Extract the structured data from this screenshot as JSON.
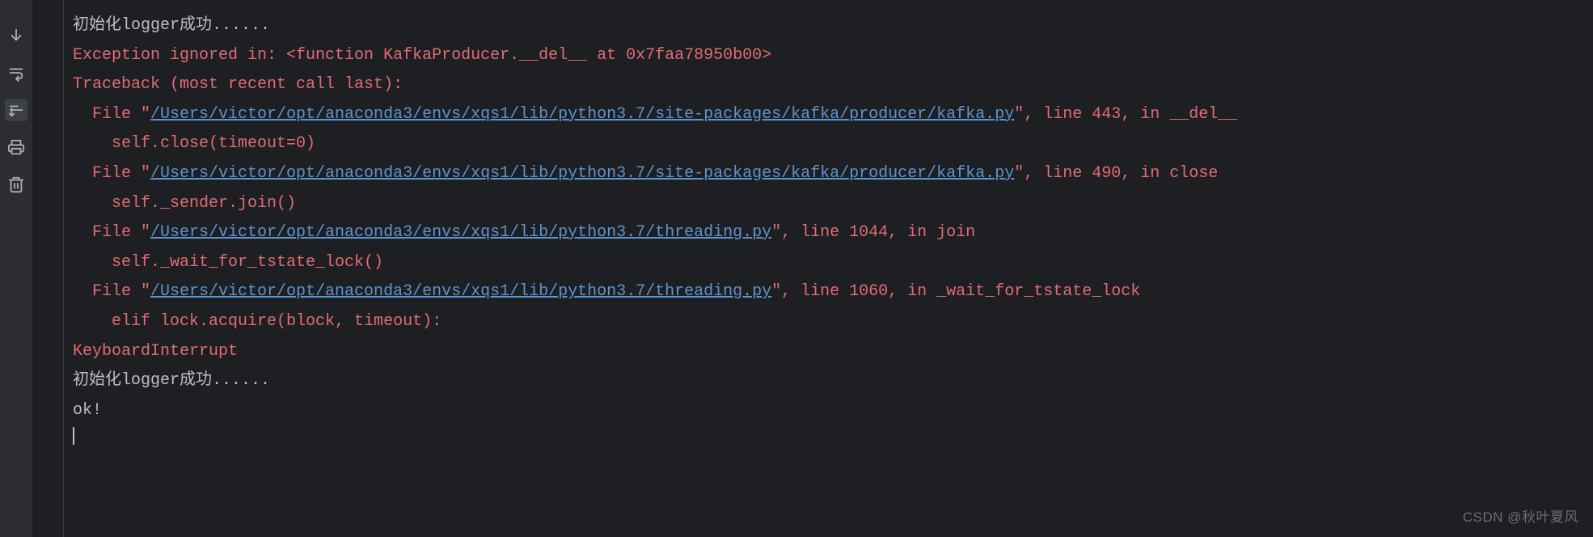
{
  "gutter": {
    "icons": [
      "down-arrow",
      "soft-wrap",
      "scroll-to-end",
      "print",
      "trash"
    ]
  },
  "console": {
    "line1": "初始化logger成功......",
    "line2": "Exception ignored in: <function KafkaProducer.__del__ at 0x7faa78950b00>",
    "line3": "Traceback (most recent call last):",
    "file_pre": "  File \"",
    "file_post_443": "\", line 443, in __del__",
    "file_post_490": "\", line 490, in close",
    "file_post_1044": "\", line 1044, in join",
    "file_post_1060": "\", line 1060, in _wait_for_tstate_lock",
    "link_kafka": "/Users/victor/opt/anaconda3/envs/xqs1/lib/python3.7/site-packages/kafka/producer/kafka.py",
    "link_threading": "/Users/victor/opt/anaconda3/envs/xqs1/lib/python3.7/threading.py",
    "indent_selfclose": "    self.close(timeout=0)",
    "indent_senderjoin": "    self._sender.join()",
    "indent_waitfortstate": "    self._wait_for_tstate_lock()",
    "indent_eliflock": "    elif lock.acquire(block, timeout):",
    "ki": "KeyboardInterrupt",
    "line_again": "初始化logger成功......",
    "ok": "ok!"
  },
  "watermark": "CSDN @秋叶夏风"
}
